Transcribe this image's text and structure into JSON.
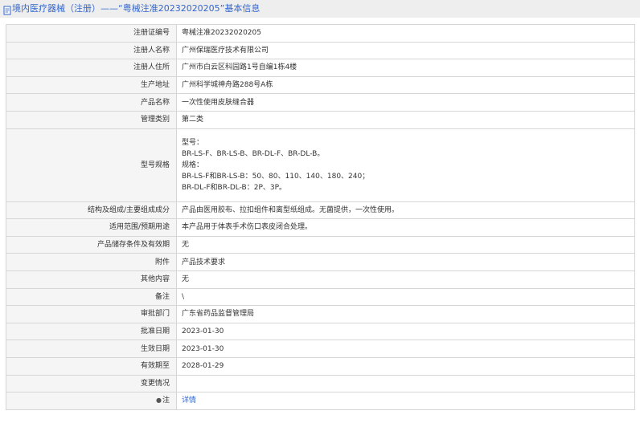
{
  "header": {
    "title": "境内医疗器械（注册）——“粤械注准20232020205”基本信息"
  },
  "rows": [
    {
      "label": "注册证编号",
      "value": "粤械注准20232020205"
    },
    {
      "label": "注册人名称",
      "value": "广州保瑞医疗技术有限公司"
    },
    {
      "label": "注册人住所",
      "value": "广州市白云区科园路1号自编1栋4楼"
    },
    {
      "label": "生产地址",
      "value": "广州科学城神舟路288号A栋"
    },
    {
      "label": "产品名称",
      "value": "一次性使用皮肤缝合器"
    },
    {
      "label": "管理类别",
      "value": "第二类"
    },
    {
      "label": "型号规格",
      "lines": [
        "型号：",
        "BR-LS-F、BR-LS-B、BR-DL-F、BR-DL-B。",
        "规格：",
        "BR-LS-F和BR-LS-B：50、80、110、140、180、240；",
        "BR-DL-F和BR-DL-B：2P、3P。"
      ]
    },
    {
      "label": "结构及组成/主要组成成分",
      "value": "产品由医用胶布、拉扣组件和离型纸组成。无菌提供，一次性使用。"
    },
    {
      "label": "适用范围/预期用途",
      "value": "本产品用于体表手术伤口表皮闭合处理。"
    },
    {
      "label": "产品储存条件及有效期",
      "value": "无"
    },
    {
      "label": "附件",
      "value": "产品技术要求"
    },
    {
      "label": "其他内容",
      "value": "无"
    },
    {
      "label": "备注",
      "value": "\\"
    },
    {
      "label": "审批部门",
      "value": "广东省药品监督管理局"
    },
    {
      "label": "批准日期",
      "value": "2023-01-30"
    },
    {
      "label": "生效日期",
      "value": "2023-01-30"
    },
    {
      "label": "有效期至",
      "value": "2028-01-29"
    },
    {
      "label": "变更情况",
      "value": ""
    }
  ],
  "note_row": {
    "star": "●",
    "label": "注",
    "link_text": "详情"
  }
}
